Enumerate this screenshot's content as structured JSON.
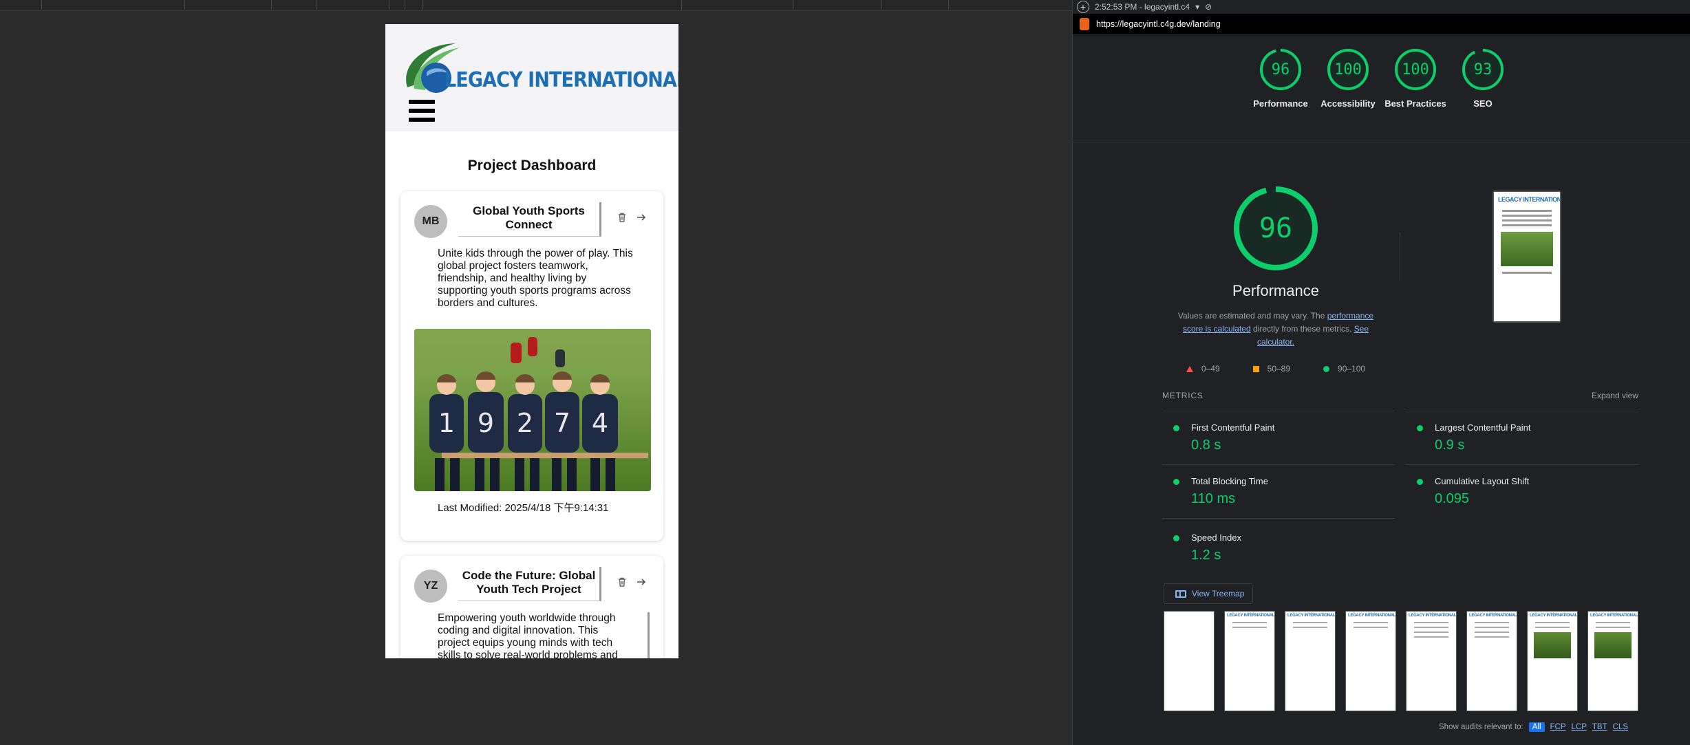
{
  "devtools": {
    "timestamp_title": "2:52:53 PM - legacyintl.c4",
    "url": "https://legacyintl.c4g.dev/landing"
  },
  "site": {
    "logo_text": "LEGACY INTERNATIONAL",
    "page_title": "Project Dashboard",
    "cards": [
      {
        "initials": "MB",
        "title": "Global Youth Sports Connect",
        "description": "Unite kids through the power of play. This global project fosters teamwork, friendship, and healthy living by supporting youth sports programs across borders and cultures.",
        "last_modified": "Last Modified: 2025/4/18 下午9:14:31"
      },
      {
        "initials": "YZ",
        "title": "Code the Future: Global Youth Tech Project",
        "description": "Empowering youth worldwide through coding and digital innovation. This project equips young minds with tech skills to solve real-world problems and"
      }
    ],
    "jersey_numbers": [
      "1",
      "9",
      "2",
      "7",
      "4"
    ]
  },
  "lighthouse": {
    "scores": [
      {
        "label": "Performance",
        "value": 96
      },
      {
        "label": "Accessibility",
        "value": 100
      },
      {
        "label": "Best Practices",
        "value": 100
      },
      {
        "label": "SEO",
        "value": 93
      }
    ],
    "performance": {
      "score": 96,
      "title": "Performance",
      "note_prefix": "Values are estimated and may vary. The ",
      "note_link1": "performance score is calculated",
      "note_middle": " directly from these metrics. ",
      "note_link2": "See calculator."
    },
    "legend": {
      "fail": "0–49",
      "average": "50–89",
      "pass": "90–100"
    },
    "metrics_header": "METRICS",
    "expand_label": "Expand view",
    "metrics": [
      {
        "name": "First Contentful Paint",
        "value": "0.8 s"
      },
      {
        "name": "Largest Contentful Paint",
        "value": "0.9 s"
      },
      {
        "name": "Total Blocking Time",
        "value": "110 ms"
      },
      {
        "name": "Cumulative Layout Shift",
        "value": "0.095"
      },
      {
        "name": "Speed Index",
        "value": "1.2 s"
      }
    ],
    "treemap_label": "View Treemap",
    "audits_filter_label": "Show audits relevant to:",
    "audits_filters": [
      "All",
      "FCP",
      "LCP",
      "TBT",
      "CLS"
    ],
    "colors": {
      "pass": "#0cce6b",
      "average": "#ffa400",
      "fail": "#ff4e42",
      "link": "#8ab4f8"
    }
  }
}
